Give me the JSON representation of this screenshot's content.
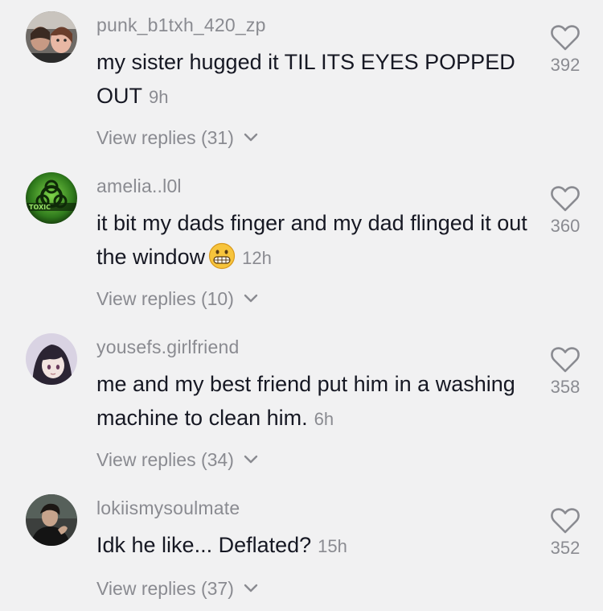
{
  "comments": [
    {
      "username": "punk_b1txh_420_zp",
      "text": "my sister hugged it TIL ITS EYES POPPED OUT",
      "time": "9h",
      "likes": "392",
      "replies": "View replies (31)",
      "avatar_icon": "user-avatar-photo"
    },
    {
      "username": "amelia..l0l",
      "text": "it bit my dads finger and my dad flinged it out the window",
      "emoji": "grimacing-face-icon",
      "time": "12h",
      "likes": "360",
      "replies": "View replies (10)",
      "avatar_icon": "biohazard-toxic-avatar"
    },
    {
      "username": "yousefs.girlfriend",
      "text": "me and my best friend put him in a washing machine to clean him.",
      "time": "6h",
      "likes": "358",
      "replies": "View replies (34)",
      "avatar_icon": "anime-character-avatar"
    },
    {
      "username": "lokiismysoulmate",
      "text": "Idk he like... Deflated?",
      "time": "15h",
      "likes": "352",
      "replies": "View replies (37)",
      "avatar_icon": "dark-portrait-avatar"
    }
  ],
  "colors": {
    "background": "#f1f1f2",
    "primary_text": "#161823",
    "secondary_text": "#8a8b91"
  }
}
